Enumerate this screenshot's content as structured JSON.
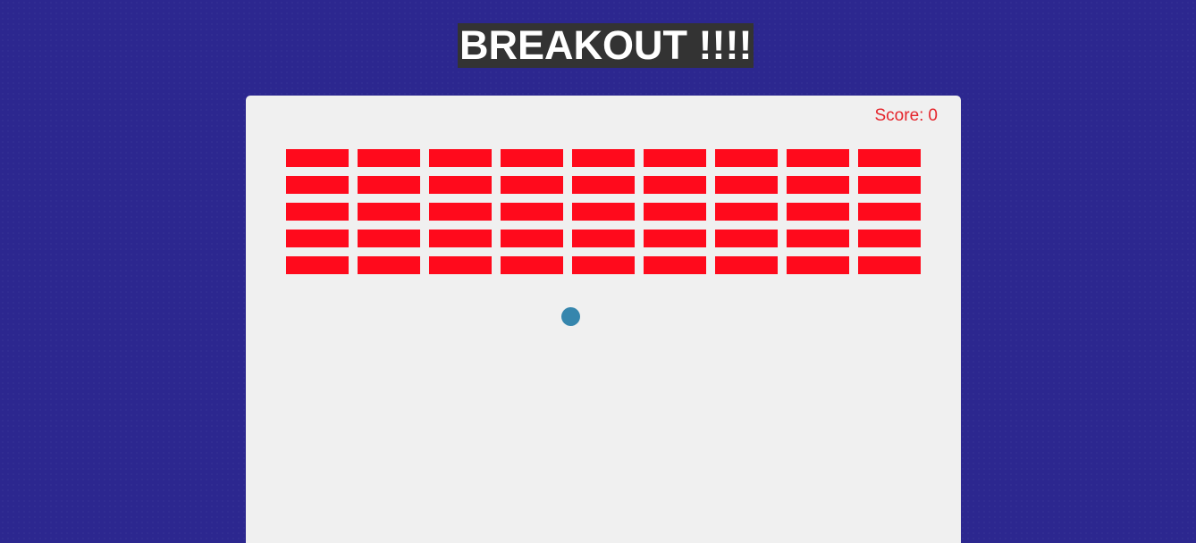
{
  "title": "BREAKOUT !!!!",
  "score": {
    "label": "Score:",
    "value": "0"
  },
  "bricks": {
    "rows": 5,
    "columns": 9,
    "color": "#ff0a1c"
  },
  "colors": {
    "background": "#2c278f",
    "board": "#f0f0f0",
    "title_background": "#333333",
    "score_text": "#e5242b",
    "ball": "#3686ad"
  }
}
